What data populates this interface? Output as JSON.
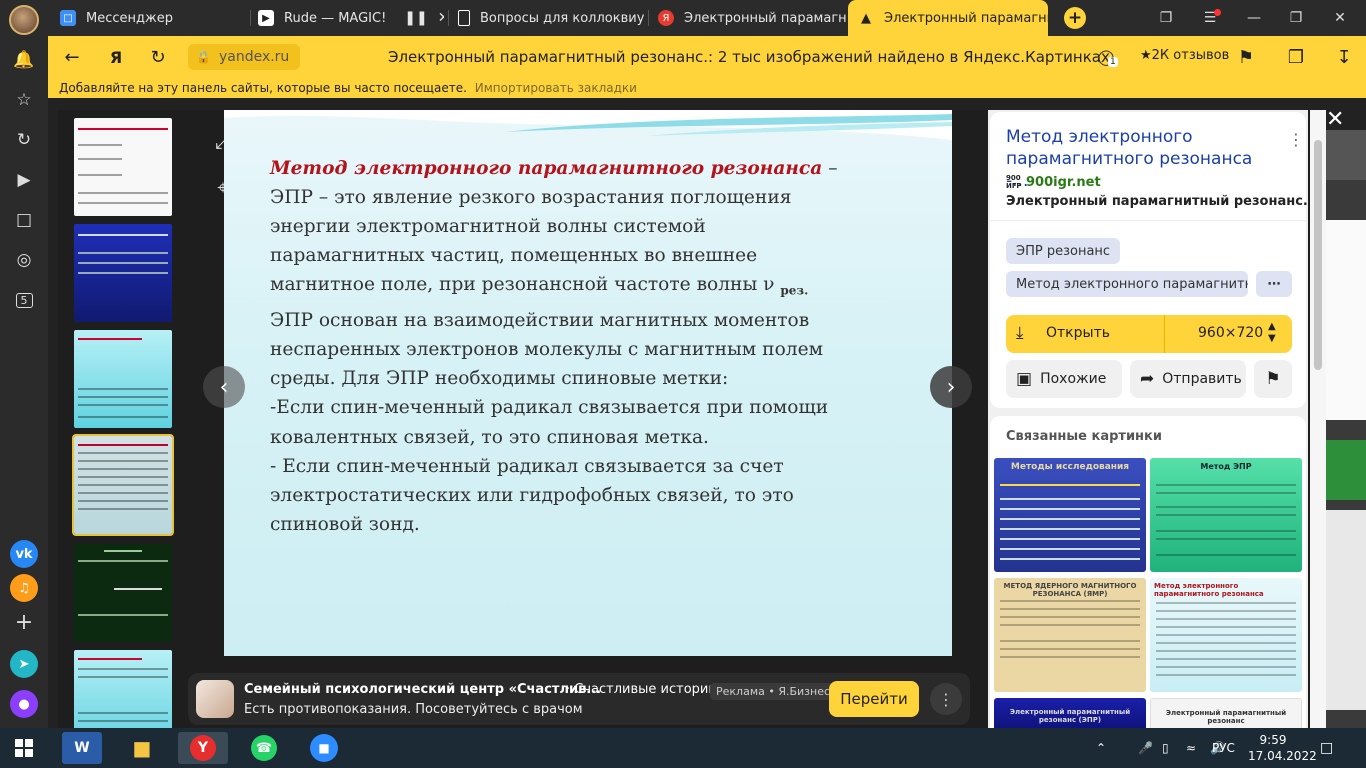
{
  "tabs": [
    {
      "label": "Мессенджер",
      "color": "#3f8ef4"
    },
    {
      "label": "Rude — MAGIC!",
      "color": "#ffffff"
    },
    {
      "label": "Вопросы для коллоквиум",
      "color": "#ffffff"
    },
    {
      "label": "Электронный парамагнит",
      "color": "#e63b2e"
    },
    {
      "label": "Электронный парамагни",
      "color": "#222222"
    }
  ],
  "address": {
    "domain": "yandex.ru",
    "page_title": "Электронный парамагнитный резонанс.: 2 тыс изображений найдено в Яндекс.Картинках",
    "reviews": "★2К отзывов",
    "badge": "1"
  },
  "bookmarks": {
    "hint": "Добавляйте на эту панель сайты, которые вы часто посещаете.",
    "import": "Импортировать закладки"
  },
  "rail_apps": [
    "vk",
    "music",
    "add",
    "messenger",
    "alice"
  ],
  "slide": {
    "heading": "Метод электронного парамагнитного резонанса",
    "dash": " –",
    "lines": [
      "ЭПР – это явление резкого возрастания поглощения",
      "энергии электромагнитной волны системой",
      "парамагнитных частиц, помещенных во внешнее",
      "магнитное поле, при резонансной частоте волны ν"
    ],
    "subscript": "рез.",
    "body": [
      "ЭПР основан на взаимодействии магнитных моментов",
      "неспаренных электронов молекулы с магнитным полем",
      "среды. Для ЭПР необходимы спиновые метки:",
      "-Если спин-меченный радикал связывается при помощи",
      "ковалентных связей, то это спиновая метка.",
      "- Если спин-меченный радикал связывается за счет",
      "электростатических или гидрофобных связей, то это",
      "спиновой зонд."
    ]
  },
  "ad": {
    "title": "Семейный психологический центр «Счастлив...",
    "subtitle": "· Счастливые истории",
    "text": "Есть противопоказания. Посоветуйтесь с врачом",
    "tag": "Реклама • Я.Бизнес",
    "button": "Перейти"
  },
  "panel": {
    "title": "Метод электронного парамагнитного резонанса -...",
    "site": "900igr.net",
    "site_icon": "900 ИГР",
    "subtitle": "Электронный парамагнитный резонанс....",
    "chips": [
      "ЭПР резонанс",
      "Метод электронного парамагнитн..."
    ],
    "open_label": "Открыть",
    "size": "960×720",
    "similar_label": "Похожие",
    "send_label": "Отправить",
    "related_heading": "Связанные картинки",
    "related": [
      {
        "title": "Методы исследования",
        "bg": "#2b3fa0"
      },
      {
        "title": "Метод ЭПР",
        "bg": "#2fcf8e"
      },
      {
        "title": "МЕТОД ЯДЕРНОГО МАГНИТНОГО РЕЗОНАНСА (ЯМР)",
        "bg": "#ead7a4"
      },
      {
        "title": "Метод электронного парамагнитного резонанса",
        "bg": "#d5f0f5"
      },
      {
        "title": "Электронный парамагнитный резонанс (ЭПР)",
        "bg": "#141a8a"
      },
      {
        "title": "Электронный парамагнитный резонанс",
        "bg": "#f4f4f4"
      }
    ]
  },
  "taskbar": {
    "lang": "РУС",
    "time": "9:59",
    "date": "17.04.2022"
  }
}
